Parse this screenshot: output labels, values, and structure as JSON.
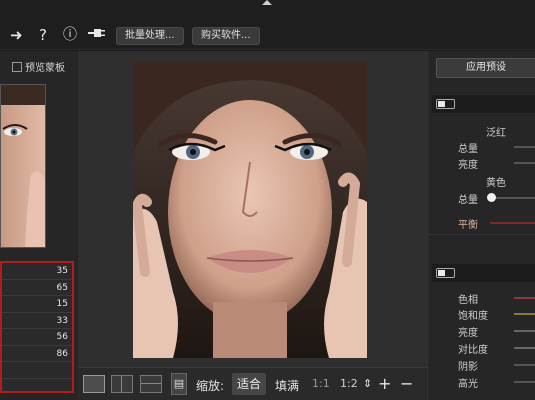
{
  "toolbar": {
    "batch_label": "批量处理...",
    "buy_label": "购买软件...",
    "icons": [
      "redo-arrow-icon",
      "help-icon",
      "info-icon",
      "plug-icon"
    ]
  },
  "left_panel": {
    "preview_mask_label": "预览蒙板",
    "stats": [
      "35",
      "65",
      "15",
      "33",
      "56",
      "86",
      ""
    ]
  },
  "bottom_bar": {
    "zoom_label": "缩放:",
    "fit_label": "适合",
    "fill_label": "填满",
    "ratio_1": "1:1",
    "ratio_2": "1:2"
  },
  "right_panel": {
    "apply_preset_label": "应用预设",
    "section1": {
      "red_group": "泛红",
      "amount": "总量",
      "brightness": "亮度",
      "yellow_group": "黄色",
      "amount2": "总量",
      "balance": "平衡"
    },
    "section2": {
      "hue": "色相",
      "saturation": "饱和度",
      "brightness": "亮度",
      "contrast": "对比度",
      "shadows": "阴影",
      "highlights": "高光"
    }
  },
  "colors": {
    "accent_red": "#b11c1c",
    "panel": "#262626",
    "background": "#1b1b1b"
  }
}
